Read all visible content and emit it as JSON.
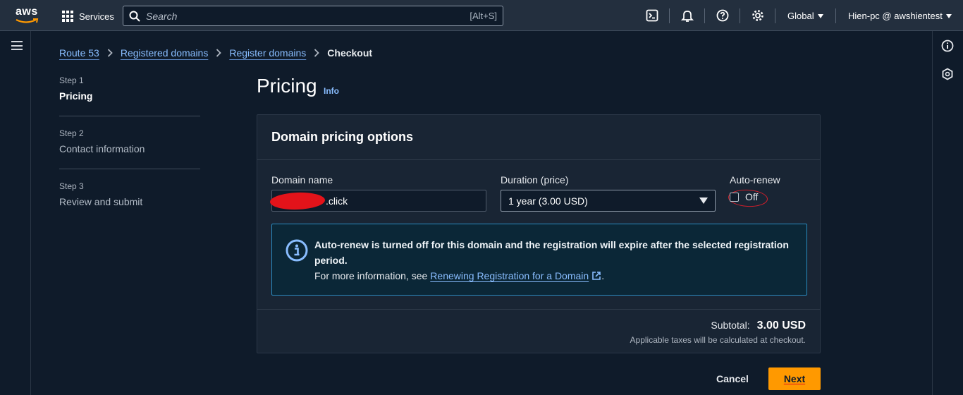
{
  "topnav": {
    "logo_text": "aws",
    "services_label": "Services",
    "search": {
      "placeholder": "Search",
      "shortcut": "[Alt+S]"
    },
    "icons": [
      "cloudshell-icon",
      "bell-icon",
      "help-icon",
      "gear-icon"
    ],
    "region_label": "Global",
    "account_label": "Hien-pc @ awshientest"
  },
  "breadcrumb": {
    "items": [
      "Route 53",
      "Registered domains",
      "Register domains"
    ],
    "current": "Checkout"
  },
  "steps": [
    {
      "num": "Step 1",
      "label": "Pricing"
    },
    {
      "num": "Step 2",
      "label": "Contact information"
    },
    {
      "num": "Step 3",
      "label": "Review and submit"
    }
  ],
  "page": {
    "title": "Pricing",
    "info_link": "Info"
  },
  "card": {
    "header": "Domain pricing options",
    "domain_label": "Domain name",
    "domain_value": ".click",
    "duration_label": "Duration (price)",
    "duration_value": "1 year (3.00 USD)",
    "autorenew_label": "Auto-renew",
    "autorenew_state": "Off",
    "alert_bold": "Auto-renew is turned off for this domain and the registration will expire after the selected registration period.",
    "alert_text": "For more information, see",
    "alert_link": "Renewing Registration for a Domain",
    "alert_period": ".",
    "subtotal_label": "Subtotal:",
    "subtotal_value": "3.00 USD",
    "tax_note": "Applicable taxes will be calculated at checkout."
  },
  "actions": {
    "cancel": "Cancel",
    "next": "Next"
  },
  "colors": {
    "accent": "#ff9900",
    "link": "#89bdff",
    "info_border": "#2b8bc0",
    "annotation_red": "#e3131a"
  }
}
